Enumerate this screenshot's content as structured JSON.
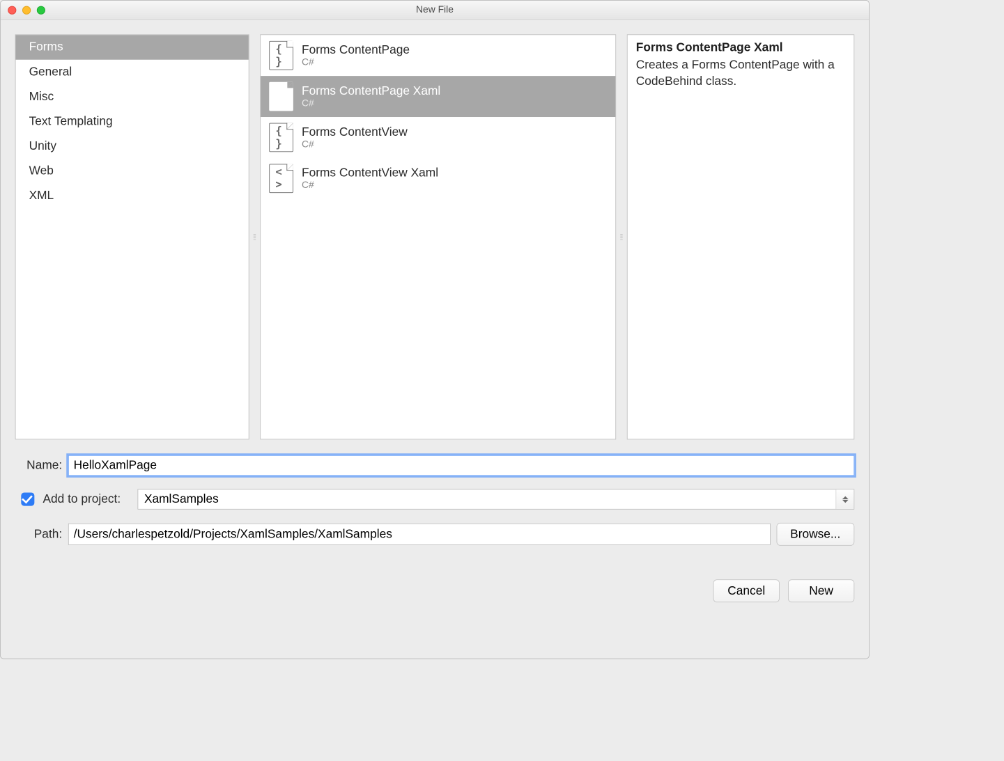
{
  "window": {
    "title": "New File"
  },
  "categories": [
    {
      "label": "Forms",
      "selected": true
    },
    {
      "label": "General",
      "selected": false
    },
    {
      "label": "Misc",
      "selected": false
    },
    {
      "label": "Text Templating",
      "selected": false
    },
    {
      "label": "Unity",
      "selected": false
    },
    {
      "label": "Web",
      "selected": false
    },
    {
      "label": "XML",
      "selected": false
    }
  ],
  "templates": [
    {
      "title": "Forms ContentPage",
      "lang": "C#",
      "icon": "{ }",
      "selected": false
    },
    {
      "title": "Forms ContentPage Xaml",
      "lang": "C#",
      "icon": "< >",
      "selected": true
    },
    {
      "title": "Forms ContentView",
      "lang": "C#",
      "icon": "{ }",
      "selected": false
    },
    {
      "title": "Forms ContentView Xaml",
      "lang": "C#",
      "icon": "< >",
      "selected": false
    }
  ],
  "description": {
    "title": "Forms ContentPage Xaml",
    "body": "Creates a Forms ContentPage with a CodeBehind class."
  },
  "form": {
    "name_label": "Name:",
    "name_value": "HelloXamlPage",
    "add_to_project_checked": true,
    "add_to_project_label": "Add to project:",
    "project_value": "XamlSamples",
    "path_label": "Path:",
    "path_value": "/Users/charlespetzold/Projects/XamlSamples/XamlSamples",
    "browse_label": "Browse..."
  },
  "footer": {
    "cancel": "Cancel",
    "new": "New"
  }
}
